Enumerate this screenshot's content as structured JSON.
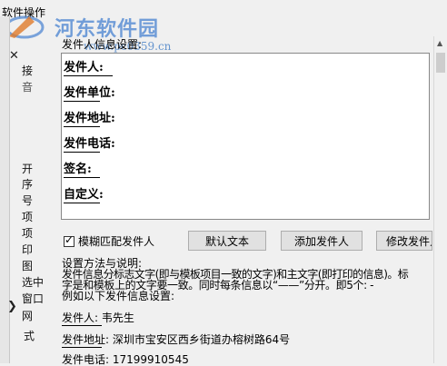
{
  "menu": {
    "label": "软件操作"
  },
  "watermark": {
    "title": "河东软件园",
    "url": "www.pc0359.cn"
  },
  "left_panel": {
    "close_glyph": "✕",
    "arrow_glyph": "❯",
    "items": [
      "接",
      "音",
      "开",
      "序",
      "号",
      "项",
      "项",
      "印",
      "图",
      "选中",
      "窗口",
      "网",
      "式"
    ]
  },
  "sender_group": {
    "title": "发件人信息设置:",
    "fields": [
      "发件人:",
      "发件单位:",
      "发件地址:",
      "发件电话:",
      "签名:",
      "自定义:"
    ]
  },
  "controls": {
    "fuzzy_match_label": "模糊匹配发件人",
    "fuzzy_match_checked": true,
    "default_text_button": "默认文本",
    "add_sender_button": "添加发件人",
    "edit_sender_button": "修改发件人"
  },
  "instructions": {
    "line1": "设置方法与说明:",
    "line2": "发件信息分标志文字(即与模板项目一致的文字)和主文字(即打印的信息)。标",
    "line3": "字是和模板上的文字要一致。同时每条信息以“——”分开。即5个: -",
    "line4": "例如以下发件信息设置:",
    "example1": "发件人: 韦先生",
    "example2": "发件地址: 深圳市宝安区西乡街道办榕树路64号",
    "example3": "发件电话: 17199910545"
  }
}
